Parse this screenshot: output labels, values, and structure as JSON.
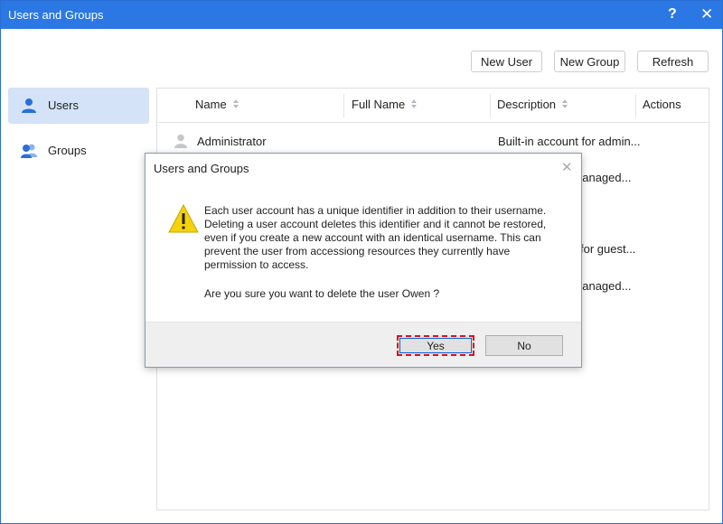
{
  "window": {
    "title": "Users and Groups",
    "help_icon": "?",
    "close_icon": "✕"
  },
  "toolbar": {
    "new_user": "New User",
    "new_group": "New Group",
    "refresh": "Refresh"
  },
  "sidebar": {
    "items": [
      {
        "label": "Users",
        "icon": "user-icon",
        "selected": true
      },
      {
        "label": "Groups",
        "icon": "group-icon",
        "selected": false
      }
    ]
  },
  "table": {
    "columns": [
      "Name",
      "Full Name",
      "Description",
      "Actions"
    ],
    "rows": [
      {
        "name": "Administrator",
        "full_name": "",
        "description": "Built-in account for admin..."
      },
      {
        "name": "",
        "full_name": "",
        "description": "nanaged..."
      },
      {
        "name": "",
        "full_name": "",
        "description": ""
      },
      {
        "name": "",
        "full_name": "",
        "description": "for guest..."
      },
      {
        "name": "",
        "full_name": "",
        "description": "nanaged..."
      }
    ]
  },
  "dialog": {
    "title": "Users and Groups",
    "close_icon": "✕",
    "message": "Each user account has a unique identifier in addition to their username. Deleting a user account deletes this identifier and it cannot be restored, even if you create a new account with an identical username. This can prevent the user from accessiong resources they currently have permission to access.",
    "question": "Are you sure you want to delete the user Owen ?",
    "yes_label": "Yes",
    "no_label": "No",
    "icon": "warning-icon"
  },
  "colors": {
    "titlebar": "#2b78e4",
    "selected_sidebar": "#d4e3f7",
    "highlight_border": "#d6141e",
    "warning_fill": "#f5d20c"
  }
}
